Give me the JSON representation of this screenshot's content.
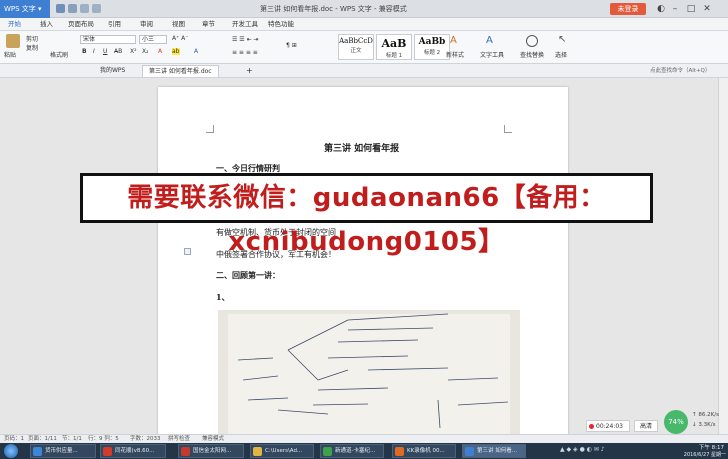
{
  "titlebar": {
    "app_menu": "WPS 文字",
    "document_title": "第三讲 如何看年报.doc - WPS 文字 - 兼容模式",
    "login_button": "未登录"
  },
  "ribbon_tabs": [
    "开始",
    "插入",
    "页面布局",
    "引用",
    "审阅",
    "视图",
    "章节",
    "开发工具",
    "特色功能"
  ],
  "ribbon": {
    "paste": "粘贴",
    "cut": "剪切",
    "copy": "复制",
    "format_painter": "格式刷",
    "font_name": "宋体",
    "font_size": "小三",
    "styles": [
      {
        "sample": "AaBbCcD",
        "label": "正文"
      },
      {
        "sample": "AaB",
        "label": "标题 1"
      },
      {
        "sample": "AaBb",
        "label": "标题 2"
      }
    ],
    "new_style": "新样式",
    "text_tools": "文字工具",
    "find_replace": "查找替换",
    "select": "选择"
  },
  "doc_tabs": {
    "home": "我的WPS",
    "active": "第三讲 如何看年报.doc",
    "search_placeholder": "点此查找命令（Alt+Q）"
  },
  "document": {
    "title": "第三讲 如何看年报",
    "heading1": "一、今日行情研判",
    "line1": "有做空机制、货币处于封闭的空间",
    "line2": "中俄签署合作协议，军工有机会！",
    "heading2": "二、回顾第一讲：",
    "item1": "1、"
  },
  "watermark": {
    "text": "需要联系微信：gudaonan66【备用：xcnibudong0105】"
  },
  "statusbar": {
    "page_num": "页码：1",
    "pages": "页面：1/11",
    "section": "节：1/1",
    "position": "行：9  列：5",
    "word_count": "字数：2033",
    "spellcheck": "拼写检查",
    "compat_mode": "兼容模式"
  },
  "recorder": {
    "time": "00:24:03",
    "quality": "高清",
    "cpu": "74%",
    "upload": "↑ 86.2K/s",
    "download": "↓ 3.3K/s"
  },
  "taskbar": {
    "items": [
      "货币供应量...",
      "同花顺(v8.60...",
      "国信金太阳网...",
      "C:\\Users\\Ad...",
      "新通道-卡塞纪...",
      "KK录像机 00...",
      "第三讲 如何看..."
    ],
    "time": "下午 8:17",
    "date": "2016/6/27 星期一"
  },
  "colors": {
    "accent": "#3f7fd1",
    "watermark_red": "#c11d1d",
    "login": "#e25a3b",
    "taskbar": "#243548"
  }
}
